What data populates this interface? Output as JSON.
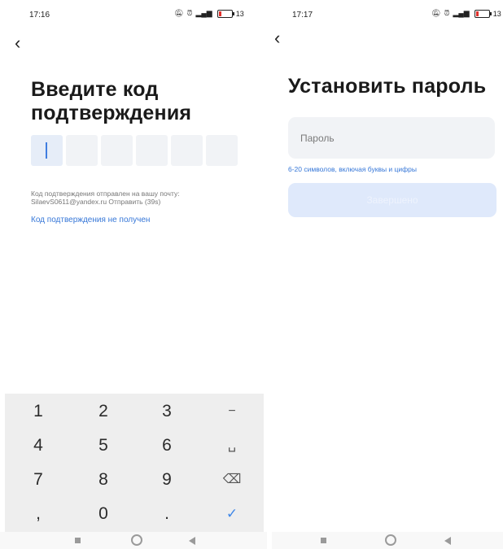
{
  "screen1": {
    "status": {
      "time": "17:16",
      "battery": "13"
    },
    "title_line1": "Введите код",
    "title_line2": "подтверждения",
    "hint_line1": "Код подтверждения отправлен на вашу почту:",
    "hint_line2": "SilaevS0611@yandex.ru Отправить (39s)",
    "link": "Код подтверждения не получен",
    "keys": [
      "1",
      "2",
      "3",
      "−",
      "4",
      "5",
      "6",
      "␣",
      "7",
      "8",
      "9",
      "⌫",
      ",",
      "0",
      ".",
      "✓"
    ]
  },
  "screen2": {
    "status": {
      "time": "17:17",
      "battery": "13"
    },
    "title": "Установить пароль",
    "password_placeholder": "Пароль",
    "password_value": "",
    "password_hint": "6-20 символов, включая буквы и цифры",
    "submit_label": "Завершено"
  },
  "icons": {
    "back": "chevron-left-icon",
    "status": [
      "dnd-icon",
      "alarm-icon",
      "signal-icon",
      "battery-icon"
    ],
    "nav": [
      "recents-icon",
      "home-icon",
      "back-icon"
    ]
  },
  "colors": {
    "accent": "#3677d8",
    "input_bg": "#f1f3f6",
    "disabled_button": "#dfe9fb",
    "keyboard_bg": "#eeeeee"
  }
}
